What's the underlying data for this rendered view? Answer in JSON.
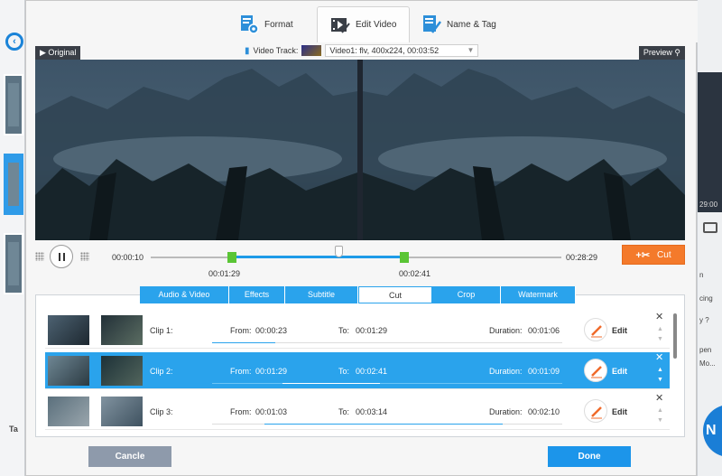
{
  "tabs": [
    {
      "label": "Format",
      "icon": "format-gear-icon"
    },
    {
      "label": "Edit Video",
      "icon": "edit-video-icon",
      "active": true
    },
    {
      "label": "Name & Tag",
      "icon": "name-tag-icon"
    }
  ],
  "preview": {
    "original_label": "Original",
    "preview_label": "Preview",
    "track_label": "Video Track:",
    "track_value": "Video1: flv, 400x224, 00:03:52"
  },
  "timeline": {
    "current_time": "00:00:10",
    "total_time": "00:28:29",
    "start_marker": "00:01:29",
    "end_marker": "00:02:41",
    "cut_label": "Cut"
  },
  "edit_tabs": [
    "Audio & Video",
    "Effects",
    "Subtitle",
    "Cut",
    "Crop",
    "Watermark"
  ],
  "active_edit_tab": "Cut",
  "clips": [
    {
      "name": "Clip 1:",
      "from_label": "From:",
      "from": "00:00:23",
      "to_label": "To:",
      "to": "00:01:29",
      "duration_label": "Duration:",
      "duration": "00:01:06",
      "edit_label": "Edit",
      "selected": false,
      "progress": [
        0.0,
        0.18
      ]
    },
    {
      "name": "Clip 2:",
      "from_label": "From:",
      "from": "00:01:29",
      "to_label": "To:",
      "to": "00:02:41",
      "duration_label": "Duration:",
      "duration": "00:01:09",
      "edit_label": "Edit",
      "selected": true,
      "progress": [
        0.2,
        0.48
      ]
    },
    {
      "name": "Clip 3:",
      "from_label": "From:",
      "from": "00:01:03",
      "to_label": "To:",
      "to": "00:03:14",
      "duration_label": "Duration:",
      "duration": "00:02:10",
      "edit_label": "Edit",
      "selected": false,
      "progress": [
        0.15,
        0.83
      ]
    }
  ],
  "buttons": {
    "cancel": "Cancle",
    "done": "Done"
  },
  "background": {
    "tag_text": "Ta",
    "right_texts": [
      "n",
      "cing",
      "y ?",
      "pen",
      "Mo..."
    ],
    "time_text": "29:00",
    "brand_letter": "N"
  },
  "colors": {
    "accent": "#2aa3ec",
    "cut_orange": "#f47a2b",
    "handle_green": "#5ac535",
    "cancel_gray": "#8e9aab",
    "done_blue": "#1c95ea"
  }
}
